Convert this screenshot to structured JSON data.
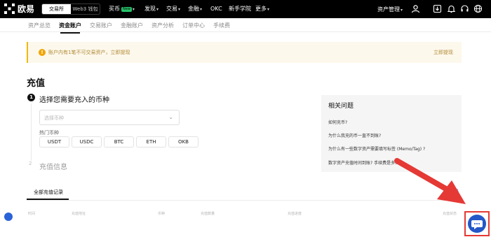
{
  "brand": {
    "name": "欧易"
  },
  "mode_switch": {
    "exchange": "交易所",
    "web3": "Web3 钱包"
  },
  "nav": {
    "items": [
      {
        "label": "买币",
        "badge": "New"
      },
      {
        "label": "发现"
      },
      {
        "label": "交易"
      },
      {
        "label": "金融"
      },
      {
        "label": "OKC"
      },
      {
        "label": "新手学院"
      },
      {
        "label": "更多"
      }
    ],
    "asset_mgmt": "资产管理"
  },
  "subnav": {
    "tabs": [
      "资产总览",
      "资金账户",
      "交易账户",
      "金融账户",
      "资产分析",
      "订单中心",
      "手续费"
    ],
    "active": "资金账户"
  },
  "notice": {
    "text": "账户内有1笔不可交易资产，立即提现",
    "link": "立即提现"
  },
  "page_title": "充值",
  "step1": {
    "number": "1",
    "title": "选择您需要充入的币种",
    "select_placeholder": "选择币种",
    "hot_label": "热门币种",
    "hot_coins": [
      "USDT",
      "USDC",
      "BTC",
      "ETH",
      "OKB"
    ]
  },
  "step2": {
    "number": "2",
    "title": "充值信息"
  },
  "help": {
    "title": "相关问题",
    "questions": [
      "如何充币?",
      "为什么我充的币一直不到账?",
      "为什么有一些数字资产需要填写标签 (Memo/Tag) ?",
      "数字资产充值时间到账? 手续费是多少?"
    ]
  },
  "records": {
    "tab": "全部充值记录",
    "more": "记录",
    "columns": [
      "时间",
      "充值地址",
      "币种",
      "充值数量",
      "充值进度",
      "充值状态"
    ]
  }
}
